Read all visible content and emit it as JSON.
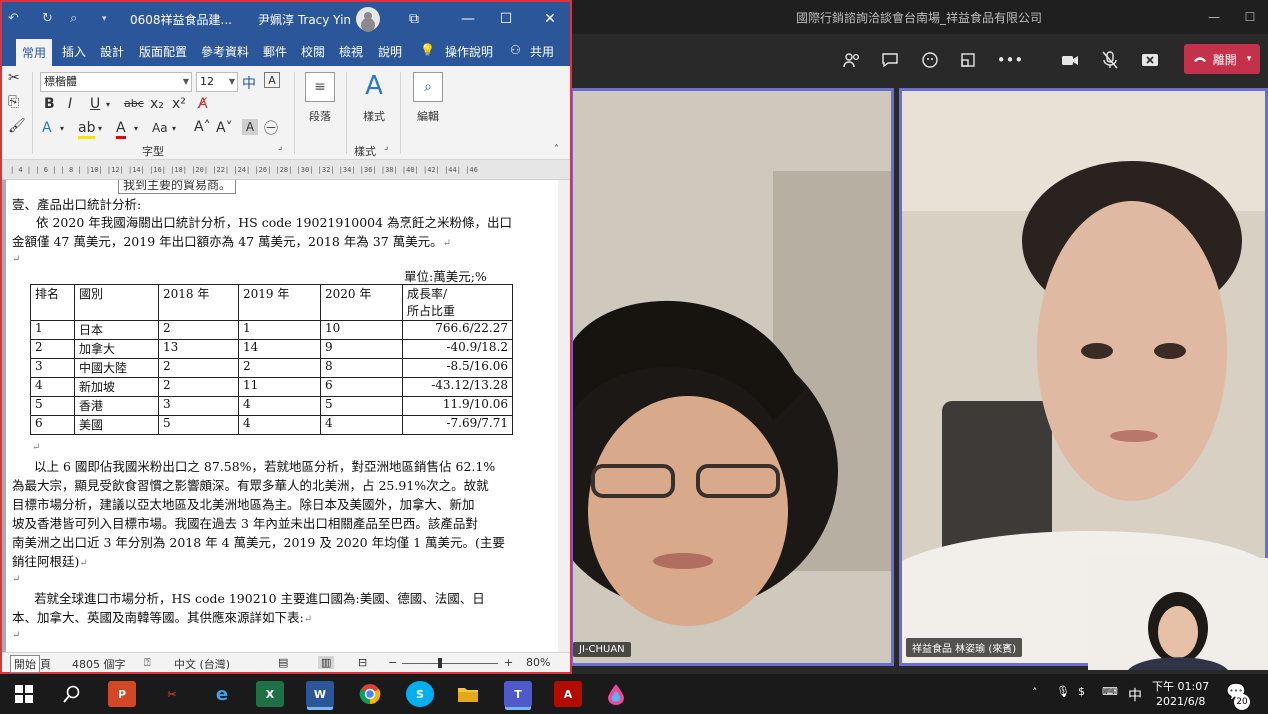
{
  "teams": {
    "title": "國際行銷諮詢洽談會台南場_祥益食品有限公司",
    "leave_label": "離開",
    "participants": [
      {
        "name": "JI-CHUAN"
      },
      {
        "name": "祥益食品 林姿瑜 (來賓)"
      }
    ]
  },
  "word": {
    "doc_title": "0608祥益食品建...",
    "user_name": "尹姵淳 Tracy Yin",
    "tabs": [
      "常用",
      "插入",
      "設計",
      "版面配置",
      "參考資料",
      "郵件",
      "校閱",
      "檢視",
      "說明",
      "操作說明",
      "共用"
    ],
    "font_name": "標楷體",
    "font_size": "12",
    "group_font": "字型",
    "group_style": "樣式",
    "btn_paragraph": "段落",
    "btn_styles": "樣式",
    "btn_edit": "編輯",
    "ruler": "| 4 |   | 6 |   | 8 |   |10|   |12|   |14|   |16|   |18|   |20|   |22|   |24|   |26|   |28|   |30|   |32|   |34|   |36|   |38|   |40|   |42|   |44|   |46",
    "status": {
      "page": "頁",
      "words": "4805 個字",
      "lang": "中文 (台灣)",
      "zoom": "80%",
      "tooltip": "開始"
    }
  },
  "doc": {
    "cutoff": "我到主要的貿易商。",
    "heading": "壹、產品出口統計分析:",
    "p1a": "依 2020 年我國海關出口統計分析，HS code 19021910004 為烹飪之米粉條，出口",
    "p1b": "金額僅 47 萬美元，2019 年出口額亦為 47 萬美元，2018 年為 37 萬美元。",
    "unit": "單位:萬美元;%",
    "table": {
      "headers": [
        "排名",
        "國別",
        "2018 年",
        "2019 年",
        "2020 年",
        "成長率/",
        "所占比重"
      ],
      "rows": [
        [
          "1",
          "日本",
          "2",
          "1",
          "10",
          "766.6/22.27"
        ],
        [
          "2",
          "加拿大",
          "13",
          "14",
          "9",
          "-40.9/18.2"
        ],
        [
          "3",
          "中國大陸",
          "2",
          "2",
          "8",
          "-8.5/16.06"
        ],
        [
          "4",
          "新加坡",
          "2",
          "11",
          "6",
          "-43.12/13.28"
        ],
        [
          "5",
          "香港",
          "3",
          "4",
          "5",
          "11.9/10.06"
        ],
        [
          "6",
          "美國",
          "5",
          "4",
          "4",
          "-7.69/7.71"
        ]
      ]
    },
    "p2": [
      "以上 6 國即佔我國米粉出口之 87.58%，若就地區分析，對亞洲地區銷售佔 62.1%",
      "為最大宗，顯見受飲食習慣之影響頗深。有眾多華人的北美洲，占 25.91%次之。故就",
      "目標市場分析，建議以亞太地區及北美洲地區為主。除日本及美國外，加拿大、新加",
      "坡及香港皆可列入目標市場。我國在過去 3 年內並未出口相關產品至巴西。該產品對",
      "南美洲之出口近 3 年分別為 2018 年 4 萬美元，2019 及 2020 年均僅 1 萬美元。(主要",
      "銷往阿根廷)"
    ],
    "p3": [
      "若就全球進口市場分析，HS code 190210 主要進口國為:美國、德國、法國、日",
      "本、加拿大、英國及南韓等國。其供應來源詳如下表:"
    ]
  },
  "taskbar": {
    "time": "下午 01:07",
    "date": "2021/6/8",
    "ime": "中",
    "notif_count": "20"
  }
}
